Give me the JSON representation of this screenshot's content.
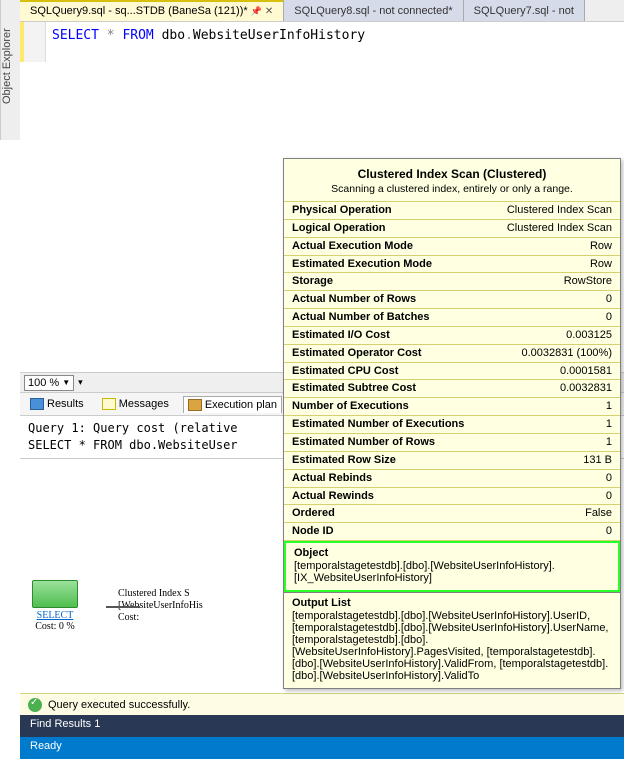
{
  "sidebar": {
    "object_explorer": "Object Explorer"
  },
  "tabs": {
    "items": [
      {
        "label": "SQLQuery9.sql - sq...STDB (BaneSa (121))*"
      },
      {
        "label": "SQLQuery8.sql - not connected*"
      },
      {
        "label": "SQLQuery7.sql - not"
      }
    ]
  },
  "editor": {
    "kw_select": "SELECT",
    "star": "*",
    "kw_from": "FROM",
    "schema": "dbo",
    "dot": ".",
    "table": "WebsiteUserInfoHistory"
  },
  "zoom": {
    "value": "100 %"
  },
  "result_tabs": {
    "results": "Results",
    "messages": "Messages",
    "plan": "Execution plan"
  },
  "query_info": {
    "line1": "Query 1: Query cost (relative",
    "line2": "SELECT * FROM dbo.WebsiteUser"
  },
  "plan": {
    "select_label": "SELECT",
    "select_cost": "Cost: 0 %",
    "scan_title": "Clustered Index S",
    "scan_table": "[WebsiteUserInfoHis",
    "scan_cost": "Cost: "
  },
  "status": {
    "text": "Query executed successfully."
  },
  "find": {
    "label": "Find Results 1"
  },
  "ready": {
    "label": "Ready"
  },
  "tooltip": {
    "title": "Clustered Index Scan (Clustered)",
    "desc": "Scanning a clustered index, entirely or only a range.",
    "rows": [
      {
        "label": "Physical Operation",
        "value": "Clustered Index Scan"
      },
      {
        "label": "Logical Operation",
        "value": "Clustered Index Scan"
      },
      {
        "label": "Actual Execution Mode",
        "value": "Row"
      },
      {
        "label": "Estimated Execution Mode",
        "value": "Row"
      },
      {
        "label": "Storage",
        "value": "RowStore"
      },
      {
        "label": "Actual Number of Rows",
        "value": "0"
      },
      {
        "label": "Actual Number of Batches",
        "value": "0"
      },
      {
        "label": "Estimated I/O Cost",
        "value": "0.003125"
      },
      {
        "label": "Estimated Operator Cost",
        "value": "0.0032831 (100%)"
      },
      {
        "label": "Estimated CPU Cost",
        "value": "0.0001581"
      },
      {
        "label": "Estimated Subtree Cost",
        "value": "0.0032831"
      },
      {
        "label": "Number of Executions",
        "value": "1"
      },
      {
        "label": "Estimated Number of Executions",
        "value": "1"
      },
      {
        "label": "Estimated Number of Rows",
        "value": "1"
      },
      {
        "label": "Estimated Row Size",
        "value": "131 B"
      },
      {
        "label": "Actual Rebinds",
        "value": "0"
      },
      {
        "label": "Actual Rewinds",
        "value": "0"
      },
      {
        "label": "Ordered",
        "value": "False"
      },
      {
        "label": "Node ID",
        "value": "0"
      }
    ],
    "object_h": "Object",
    "object_body": "[temporalstagetestdb].[dbo].[WebsiteUserInfoHistory].[IX_WebsiteUserInfoHistory]",
    "output_h": "Output List",
    "output_body": "[temporalstagetestdb].[dbo].[WebsiteUserInfoHistory].UserID, [temporalstagetestdb].[dbo].[WebsiteUserInfoHistory].UserName, [temporalstagetestdb].[dbo].[WebsiteUserInfoHistory].PagesVisited, [temporalstagetestdb].[dbo].[WebsiteUserInfoHistory].ValidFrom, [temporalstagetestdb].[dbo].[WebsiteUserInfoHistory].ValidTo"
  }
}
